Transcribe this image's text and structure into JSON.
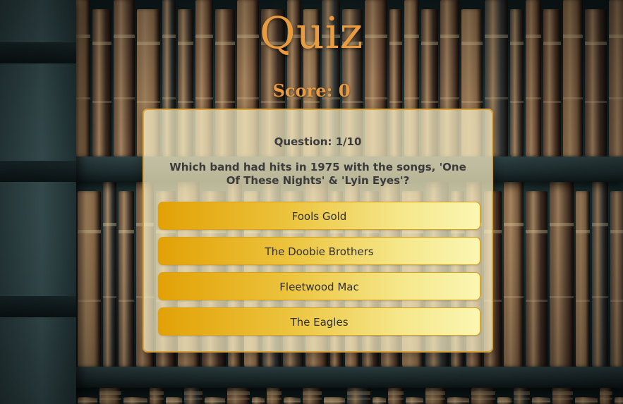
{
  "header": {
    "title": "Quiz",
    "score_label": "Score: ",
    "score_value": "0"
  },
  "question": {
    "counter": "Question: 1/10",
    "text": "Which band had hits in 1975 with the songs, 'One Of These Nights' & 'Lyin Eyes'?"
  },
  "answers": [
    {
      "label": "Fools Gold"
    },
    {
      "label": "The Doobie Brothers"
    },
    {
      "label": "Fleetwood Mac"
    },
    {
      "label": "The Eagles"
    }
  ],
  "colors": {
    "title": "#e99b3f",
    "card_border": "#d7a23a",
    "button_start": "#e2a106",
    "button_end": "#faf6b2",
    "text": "#3b3b3b"
  }
}
